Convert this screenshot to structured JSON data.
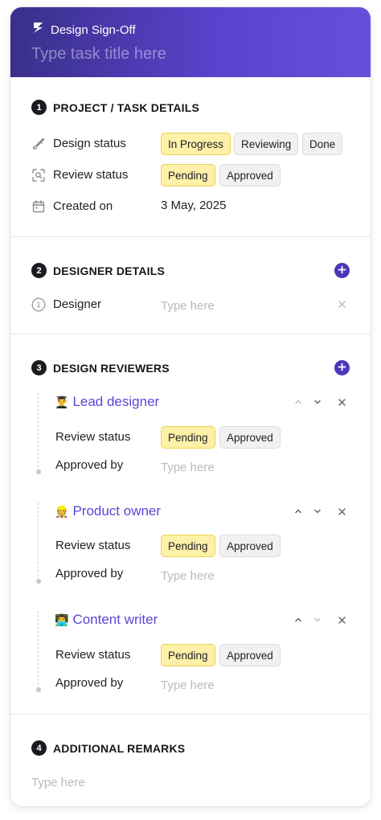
{
  "header": {
    "app_title": "Design Sign-Off",
    "title_placeholder": "Type task title here"
  },
  "section1": {
    "number": "1",
    "title": "PROJECT / TASK DETAILS",
    "design_status": {
      "label": "Design status",
      "options": [
        "In Progress",
        "Reviewing",
        "Done"
      ],
      "selected": "In Progress"
    },
    "review_status": {
      "label": "Review status",
      "options": [
        "Pending",
        "Approved"
      ],
      "selected": "Pending"
    },
    "created_on": {
      "label": "Created on",
      "value": "3 May, 2025"
    }
  },
  "section2": {
    "number": "2",
    "title": "DESIGNER DETAILS",
    "designer": {
      "index": "1",
      "label": "Designer",
      "placeholder": "Type here"
    }
  },
  "section3": {
    "number": "3",
    "title": "DESIGN REVIEWERS",
    "reviewers": [
      {
        "emoji": "👨‍🎓",
        "name": "Lead designer",
        "review_label": "Review status",
        "options": [
          "Pending",
          "Approved"
        ],
        "selected": "Pending",
        "approved_label": "Approved by",
        "approved_placeholder": "Type here"
      },
      {
        "emoji": "👷",
        "name": "Product owner",
        "review_label": "Review status",
        "options": [
          "Pending",
          "Approved"
        ],
        "selected": "Pending",
        "approved_label": "Approved by",
        "approved_placeholder": "Type here"
      },
      {
        "emoji": "👨‍💻",
        "name": "Content writer",
        "review_label": "Review status",
        "options": [
          "Pending",
          "Approved"
        ],
        "selected": "Pending",
        "approved_label": "Approved by",
        "approved_placeholder": "Type here"
      }
    ]
  },
  "section4": {
    "number": "4",
    "title": "ADDITIONAL REMARKS",
    "placeholder": "Type here"
  },
  "colors": {
    "header_gradient_start": "#3a2f8a",
    "header_gradient_end": "#6550dc",
    "accent": "#5b45d6",
    "selected_chip": "#fdf0a8",
    "selected_chip_border": "#ecd34f"
  }
}
